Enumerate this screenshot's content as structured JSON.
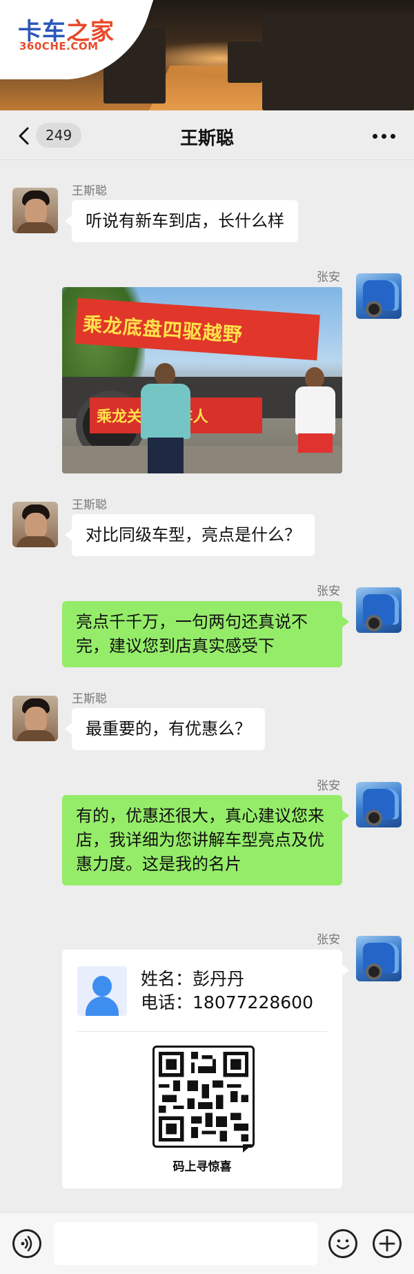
{
  "brand": {
    "logo_cn_part1": "卡车",
    "logo_cn_part2": "之家",
    "logo_en": "360CHE.COM",
    "colors": {
      "blue": "#2a57b8",
      "orange": "#e84a2b"
    }
  },
  "header": {
    "back_icon": "chevron-left-icon",
    "unread_count": "249",
    "title": "王斯聪",
    "more_icon": "more-dots-icon"
  },
  "messages": [
    {
      "side": "left",
      "sender": "王斯聪",
      "type": "text",
      "text": "听说有新车到店，长什么样"
    },
    {
      "side": "right",
      "sender": "张安",
      "type": "image",
      "image_text_banner_top": "乘龙底盘四驱越野",
      "image_text_banner_bottom": "乘龙关   富卡车人"
    },
    {
      "side": "left",
      "sender": "王斯聪",
      "type": "text",
      "text": "对比同级车型，亮点是什么？"
    },
    {
      "side": "right",
      "sender": "张安",
      "type": "text",
      "text": "亮点千千万，一句两句还真说不完，建议您到店真实感受下"
    },
    {
      "side": "left",
      "sender": "王斯聪",
      "type": "text",
      "text": "最重要的，有优惠么？"
    },
    {
      "side": "right",
      "sender": "张安",
      "type": "text",
      "text": "有的，优惠还很大，真心建议您来店，我详细为您讲解车型亮点及优惠力度。这是我的名片"
    },
    {
      "side": "right",
      "sender": "张安",
      "type": "card",
      "card": {
        "name_label": "姓名：",
        "name": "彭丹丹",
        "phone_label": "电话：",
        "phone": "18077228600",
        "qr_caption": "码上寻惊喜"
      }
    }
  ],
  "input_bar": {
    "voice_icon": "voice-icon",
    "input_value": "",
    "emoji_icon": "emoji-icon",
    "plus_icon": "plus-icon"
  },
  "colors": {
    "background": "#ededed",
    "bubble_self": "#95ec69",
    "bubble_other": "#ffffff"
  }
}
